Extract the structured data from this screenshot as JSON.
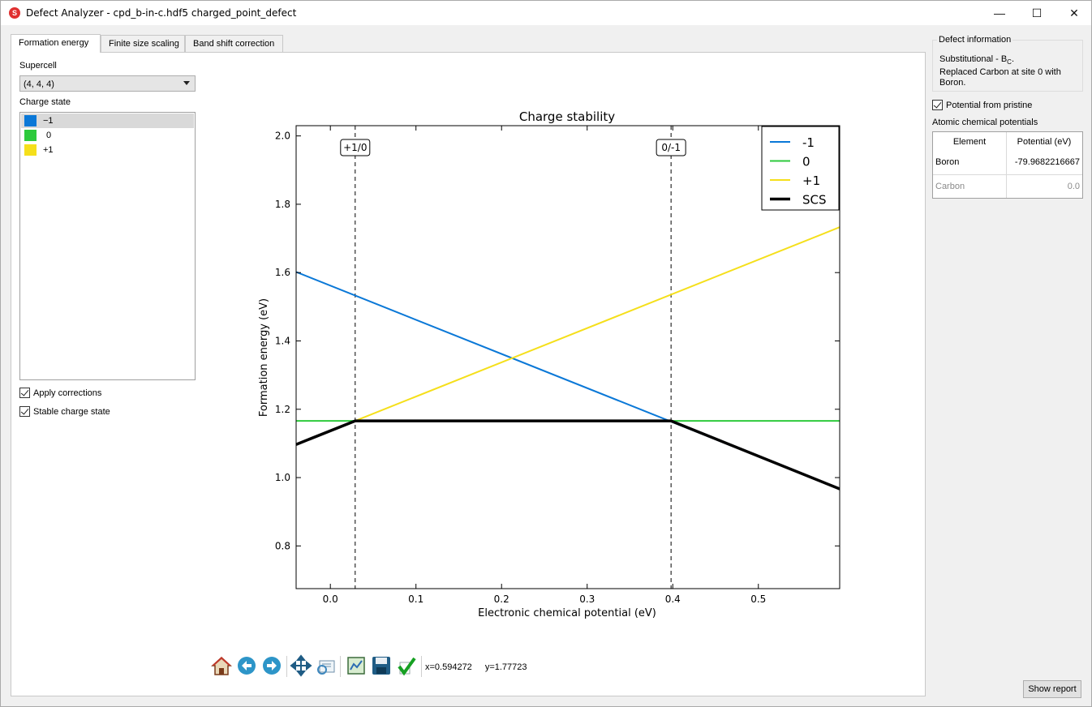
{
  "window": {
    "title": "Defect Analyzer - cpd_b-in-c.hdf5 charged_point_defect",
    "app_icon_letter": "S",
    "min_glyph": "—",
    "max_glyph": "☐",
    "close_glyph": "✕"
  },
  "tabs": [
    {
      "label": "Formation energy",
      "active": true
    },
    {
      "label": "Finite size scaling",
      "active": false
    },
    {
      "label": "Band shift correction",
      "active": false
    }
  ],
  "left": {
    "supercell_label": "Supercell",
    "supercell_value": "(4, 4, 4)",
    "charge_state_label": "Charge state",
    "charge_states": [
      {
        "label": "−1",
        "color": "#0a78d7",
        "selected": true
      },
      {
        "label": "0",
        "color": "#2dca3c",
        "selected": false
      },
      {
        "label": "+1",
        "color": "#f5df1b",
        "selected": false
      }
    ],
    "apply_corrections_label": "Apply corrections",
    "apply_corrections_checked": true,
    "stable_charge_state_label": "Stable charge state",
    "stable_charge_state_checked": true
  },
  "chart_data": {
    "type": "line",
    "title": "Charge stability",
    "xlabel": "Electronic chemical potential (eV)",
    "ylabel": "Formation energy (eV)",
    "xlim": [
      -0.04,
      0.595
    ],
    "ylim": [
      0.675,
      2.03
    ],
    "xticks": [
      0.0,
      0.1,
      0.2,
      0.3,
      0.4,
      0.5
    ],
    "xtick_labels": [
      "0.0",
      "0.1",
      "0.2",
      "0.3",
      "0.4",
      "0.5"
    ],
    "yticks": [
      0.8,
      1.0,
      1.2,
      1.4,
      1.6,
      1.8,
      2.0
    ],
    "ytick_labels": [
      "0.8",
      "1.0",
      "1.2",
      "1.4",
      "1.6",
      "1.8",
      "2.0"
    ],
    "legend_position": "top-right",
    "grid": false,
    "series": [
      {
        "name": "-1",
        "color": "#0a78d7",
        "width": 2,
        "x": [
          -0.04,
          0.595
        ],
        "y": [
          1.602,
          0.967
        ]
      },
      {
        "name": "0",
        "color": "#2dca3c",
        "width": 2,
        "x": [
          -0.04,
          0.595
        ],
        "y": [
          1.166,
          1.166
        ]
      },
      {
        "name": "+1",
        "color": "#f5df1b",
        "width": 2,
        "x": [
          -0.04,
          0.595
        ],
        "y": [
          1.097,
          1.733
        ]
      },
      {
        "name": "SCS",
        "color": "#000000",
        "width": 3.5,
        "x": [
          -0.04,
          0.029,
          0.398,
          0.595
        ],
        "y": [
          1.097,
          1.166,
          1.166,
          0.967
        ]
      }
    ],
    "transitions": [
      {
        "label": "+1/0",
        "x": 0.029
      },
      {
        "label": "0/-1",
        "x": 0.398
      }
    ]
  },
  "toolbar": {
    "icons": [
      "home-icon",
      "back-icon",
      "forward-icon",
      "pan-icon",
      "zoom-icon",
      "subplots-icon",
      "save-icon",
      "edit-check-icon"
    ],
    "coord_x": "x=0.594272",
    "coord_y": "y=1.77723"
  },
  "right": {
    "defect_info_title": "Defect information",
    "defect_line1_prefix": "Substitutional - B",
    "defect_line1_sub": "C",
    "defect_line1_suffix": ".",
    "defect_line2": "Replaced Carbon at site 0 with Boron.",
    "potential_from_pristine_label": "Potential from pristine",
    "potential_from_pristine_checked": true,
    "atomic_potentials_label": "Atomic chemical potentials",
    "table": {
      "headers": [
        "Element",
        "Potential (eV)"
      ],
      "rows": [
        {
          "element": "Boron",
          "potential": "-79.9682216667",
          "enabled": true
        },
        {
          "element": "Carbon",
          "potential": "0.0",
          "enabled": false
        }
      ]
    },
    "show_report_label": "Show report"
  }
}
